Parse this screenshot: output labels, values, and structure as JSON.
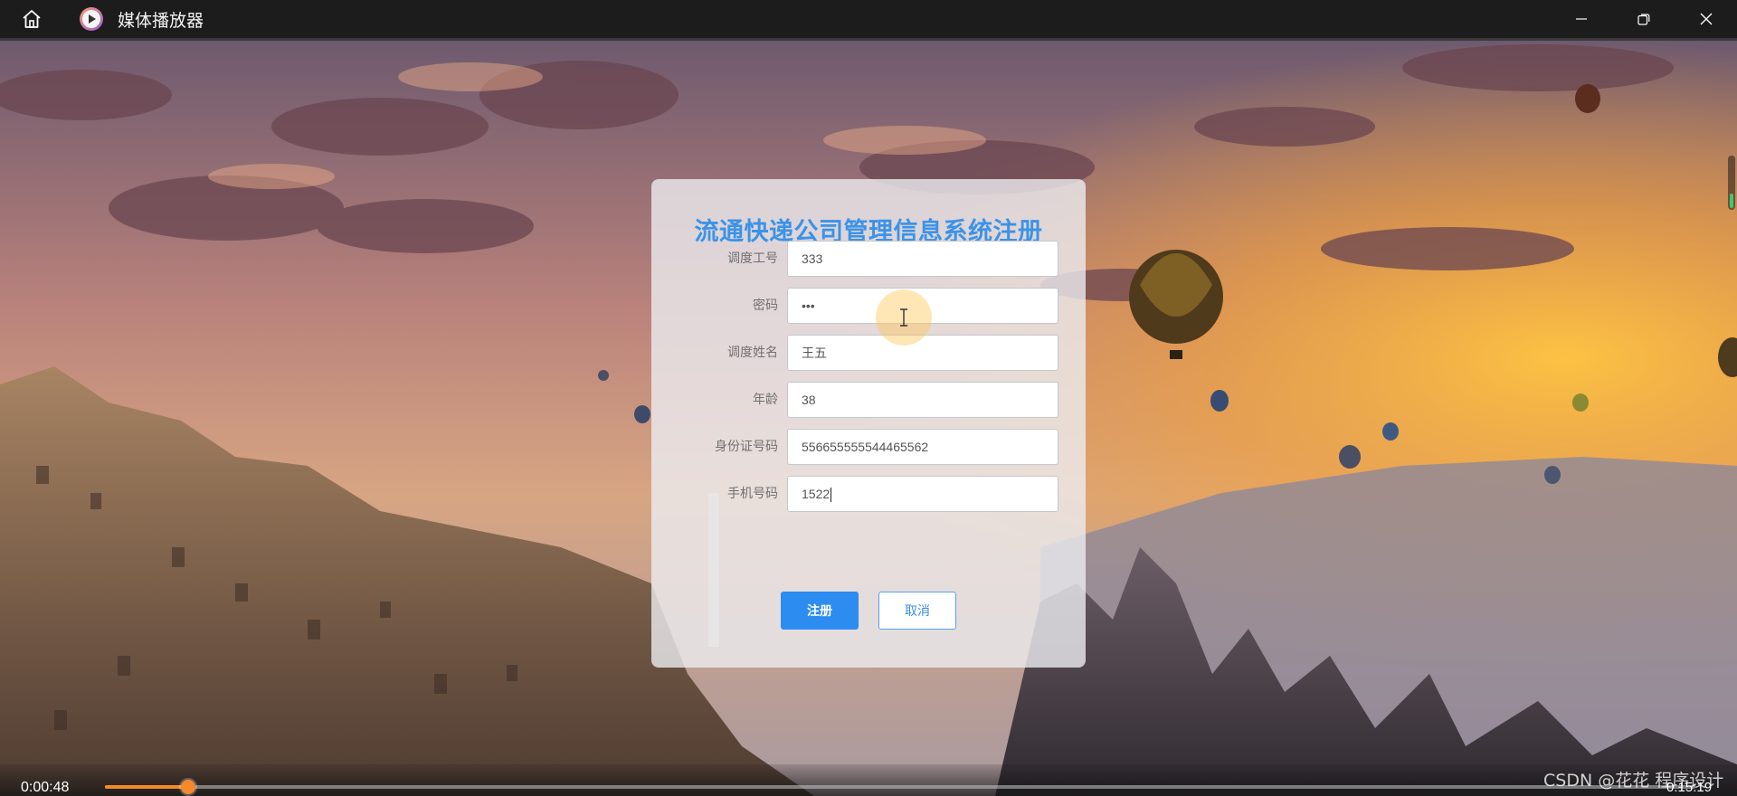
{
  "titlebar": {
    "app_title": "媒体播放器",
    "icons": [
      "home-icon",
      "media-player-app-icon",
      "minimize-icon",
      "restore-icon",
      "close-icon"
    ]
  },
  "form": {
    "title": "流通快递公司管理信息系统注册",
    "fields": [
      {
        "label": "调度工号",
        "value": "333"
      },
      {
        "label": "密码",
        "value": "•••"
      },
      {
        "label": "调度姓名",
        "value": "王五"
      },
      {
        "label": "年龄",
        "value": "38"
      },
      {
        "label": "身份证号码",
        "value": "556655555544465562"
      },
      {
        "label": "手机号码",
        "value": "1522"
      }
    ],
    "submit_label": "注册",
    "cancel_label": "取消"
  },
  "player": {
    "current_time": "0:00:48",
    "total_time": "0:15:19",
    "progress_fraction": 0.0522
  },
  "watermark": "CSDN @花花 程序设计",
  "colors": {
    "accent": "#2d8cf0",
    "title_blue": "#3b93e8",
    "progress": "#f28a2a"
  }
}
